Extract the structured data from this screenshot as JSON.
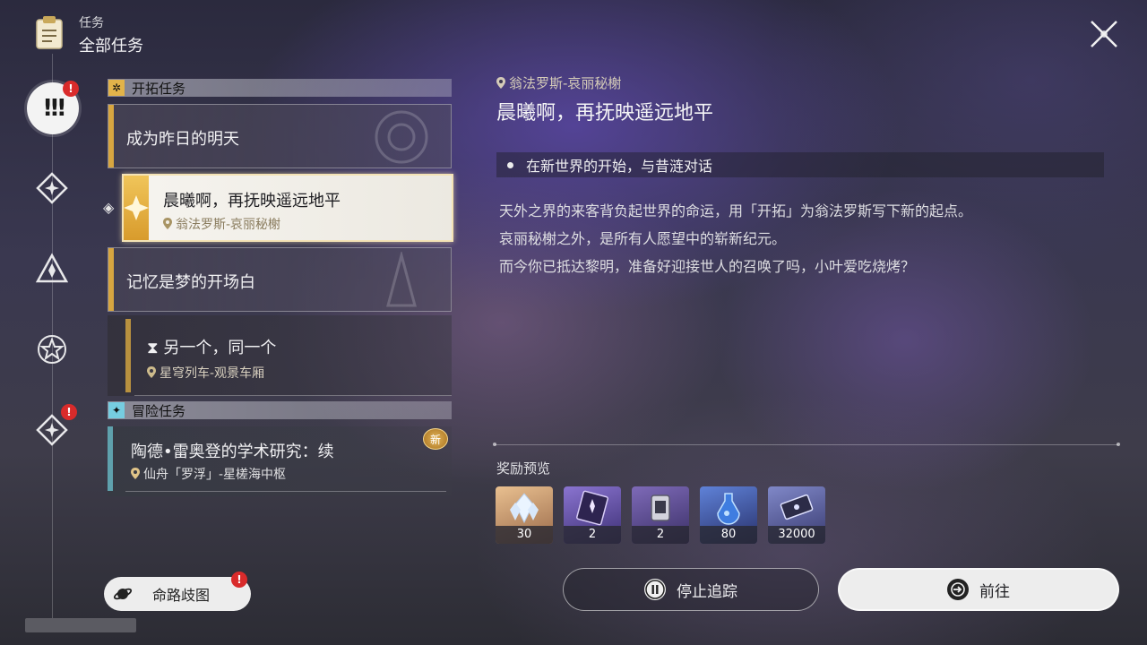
{
  "header": {
    "category": "任务",
    "title": "全部任务"
  },
  "close_icon": "close-icon",
  "rail": {
    "items": [
      {
        "name": "all-quests",
        "icon": "exclamation-icon",
        "active": true,
        "badge": "!"
      },
      {
        "name": "trailblaze",
        "icon": "star-diamond-icon",
        "active": false
      },
      {
        "name": "companion",
        "icon": "triangle-icon",
        "active": false
      },
      {
        "name": "daily",
        "icon": "star-circle-icon",
        "active": false
      },
      {
        "name": "adventure",
        "icon": "star-diamond-icon",
        "active": false,
        "badge": "!"
      }
    ]
  },
  "sections": {
    "trailblaze": {
      "label": "开拓任务",
      "quests": [
        {
          "title": "成为昨日的明天"
        },
        {
          "title": "晨曦啊，再抚映遥远地平",
          "location": "翁法罗斯-哀丽秘榭",
          "selected": true
        },
        {
          "title": "记忆是梦的开场白"
        },
        {
          "title": "另一个，同一个",
          "location": "星穹列车-观景车厢",
          "hourglass": "⧗"
        }
      ]
    },
    "adventure": {
      "label": "冒险任务",
      "quests": [
        {
          "title": "陶德•雷奥登的学术研究：续",
          "location": "仙舟「罗浮」-星槎海中枢",
          "badge": "新"
        }
      ]
    }
  },
  "route_button": {
    "label": "命路歧图",
    "badge": "!"
  },
  "detail": {
    "location": "翁法罗斯-哀丽秘榭",
    "title": "晨曦啊，再抚映遥远地平",
    "objective": "在新世界的开始，与昔涟对话",
    "description": [
      "天外之界的来客背负起世界的命运，用「开拓」为翁法罗斯写下新的起点。",
      "哀丽秘榭之外，是所有人愿望中的崭新纪元。",
      "而今你已抵达黎明，准备好迎接世人的召唤了吗，小叶爱吃烧烤？"
    ],
    "reward_title": "奖励预览",
    "rewards": [
      {
        "name": "stellar-jade",
        "count": "30",
        "color": "#c89a62"
      },
      {
        "name": "purple-card",
        "count": "2",
        "color": "#5a4a8e"
      },
      {
        "name": "purple-gear",
        "count": "2",
        "color": "#5b4a84"
      },
      {
        "name": "blue-potion",
        "count": "80",
        "color": "#3f5aa8"
      },
      {
        "name": "credit-ticket",
        "count": "32000",
        "color": "#555a8e"
      }
    ]
  },
  "buttons": {
    "stop_tracking": "停止追踪",
    "go": "前往"
  }
}
